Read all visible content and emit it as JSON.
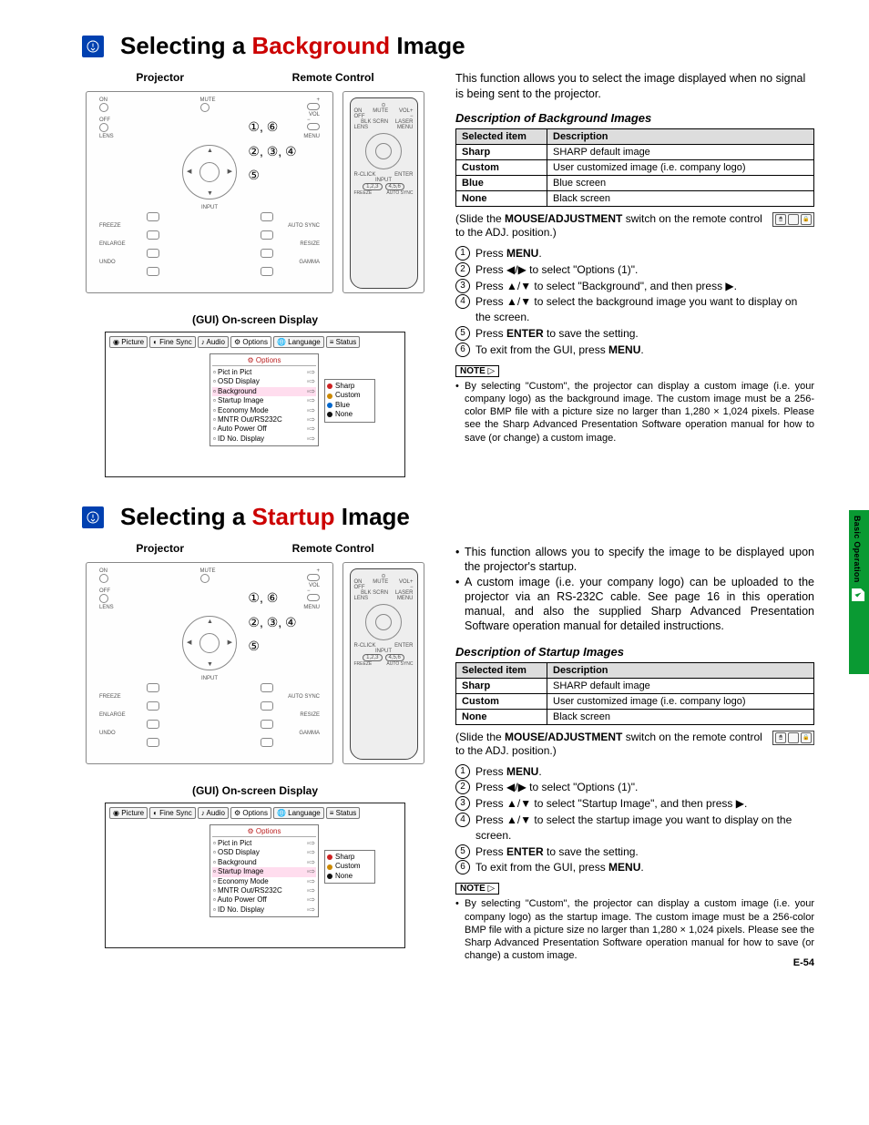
{
  "page_number": "E-54",
  "side_tab": "Basic Operation",
  "sections": [
    {
      "title_pre": "Selecting a ",
      "title_hl": "Background",
      "title_post": " Image",
      "label_projector": "Projector",
      "label_remote": "Remote Control",
      "callouts": [
        "①, ⑥",
        "②, ③, ④",
        "⑤"
      ],
      "osd_title": "(GUI) On-screen Display",
      "osd_menubar": [
        "Picture",
        "Fine Sync",
        "Audio",
        "Options",
        "Language",
        "Status"
      ],
      "osd_header": "Options",
      "osd_rows": [
        {
          "label": "Pict in Pict",
          "hi": false
        },
        {
          "label": "OSD Display",
          "hi": false
        },
        {
          "label": "Background",
          "hi": true
        },
        {
          "label": "Startup Image",
          "hi": false
        },
        {
          "label": "Economy Mode",
          "hi": false
        },
        {
          "label": "MNTR Out/RS232C",
          "hi": false
        },
        {
          "label": "Auto Power Off",
          "hi": false
        },
        {
          "label": "ID No. Display",
          "hi": false
        }
      ],
      "osd_side": [
        {
          "label": "Sharp",
          "color": "#c22"
        },
        {
          "label": "Custom",
          "color": "#c80"
        },
        {
          "label": "Blue",
          "color": "#06c"
        },
        {
          "label": "None",
          "color": "#111"
        }
      ],
      "intro": "This function allows you to select the image displayed when no signal is being sent to the projector.",
      "intro_bullets": [],
      "desc_heading": "Description of Background Images",
      "table_headers": [
        "Selected item",
        "Description"
      ],
      "table_rows": [
        [
          "Sharp",
          "SHARP default image"
        ],
        [
          "Custom",
          "User customized image (i.e. company logo)"
        ],
        [
          "Blue",
          "Blue screen"
        ],
        [
          "None",
          "Black screen"
        ]
      ],
      "slide_note_pre": "(Slide the ",
      "slide_note_bold": "MOUSE/ADJUSTMENT",
      "slide_note_post": " switch on the remote control to the ADJ. position.)",
      "switch_labels": [
        "MOUSE",
        "→",
        "ADJ."
      ],
      "steps": [
        {
          "n": "1",
          "html": "Press <b>MENU</b>."
        },
        {
          "n": "2",
          "html": "Press ◀/▶ to select \"Options (1)\"."
        },
        {
          "n": "3",
          "html": "Press ▲/▼ to select \"Background\", and then press ▶."
        },
        {
          "n": "4",
          "html": "Press ▲/▼ to select the background image you want to display on the screen."
        },
        {
          "n": "5",
          "html": "Press <b>ENTER</b> to save the setting."
        },
        {
          "n": "6",
          "html": "To exit from the GUI, press <b>MENU</b>."
        }
      ],
      "note_label": "NOTE",
      "notes": [
        "By selecting \"Custom\", the projector can display a custom image (i.e. your company logo) as the background image. The custom image must be a 256-color BMP file with a picture size no larger than 1,280 × 1,024 pixels. Please see the Sharp Advanced Presentation Software operation manual for how to save (or change) a custom image."
      ]
    },
    {
      "title_pre": "Selecting a ",
      "title_hl": "Startup",
      "title_post": " Image",
      "label_projector": "Projector",
      "label_remote": "Remote Control",
      "callouts": [
        "①, ⑥",
        "②, ③, ④",
        "⑤"
      ],
      "osd_title": "(GUI) On-screen Display",
      "osd_menubar": [
        "Picture",
        "Fine Sync",
        "Audio",
        "Options",
        "Language",
        "Status"
      ],
      "osd_header": "Options",
      "osd_rows": [
        {
          "label": "Pict in Pict",
          "hi": false
        },
        {
          "label": "OSD Display",
          "hi": false
        },
        {
          "label": "Background",
          "hi": false
        },
        {
          "label": "Startup Image",
          "hi": true
        },
        {
          "label": "Economy Mode",
          "hi": false
        },
        {
          "label": "MNTR Out/RS232C",
          "hi": false
        },
        {
          "label": "Auto Power Off",
          "hi": false
        },
        {
          "label": "ID No. Display",
          "hi": false
        }
      ],
      "osd_side": [
        {
          "label": "Sharp",
          "color": "#c22"
        },
        {
          "label": "Custom",
          "color": "#c80"
        },
        {
          "label": "None",
          "color": "#111"
        }
      ],
      "intro": "",
      "intro_bullets": [
        "This function allows you to specify the image to be displayed upon the projector's startup.",
        "A custom image (i.e. your company logo) can be uploaded to the projector via an RS-232C cable. See page 16 in this operation manual, and also the supplied Sharp Advanced Presentation Software operation manual for detailed instructions."
      ],
      "desc_heading": "Description of Startup Images",
      "table_headers": [
        "Selected item",
        "Description"
      ],
      "table_rows": [
        [
          "Sharp",
          "SHARP default image"
        ],
        [
          "Custom",
          "User customized image (i.e. company logo)"
        ],
        [
          "None",
          "Black screen"
        ]
      ],
      "slide_note_pre": "(Slide the ",
      "slide_note_bold": "MOUSE/ADJUSTMENT",
      "slide_note_post": " switch on the remote control to the ADJ. position.)",
      "switch_labels": [
        "MOUSE",
        "→",
        "ADJ."
      ],
      "steps": [
        {
          "n": "1",
          "html": "Press <b>MENU</b>."
        },
        {
          "n": "2",
          "html": "Press ◀/▶ to select \"Options (1)\"."
        },
        {
          "n": "3",
          "html": "Press ▲/▼ to select \"Startup Image\", and then press ▶."
        },
        {
          "n": "4",
          "html": "Press ▲/▼ to select the startup image you want to display on the screen."
        },
        {
          "n": "5",
          "html": "Press <b>ENTER</b> to save the setting."
        },
        {
          "n": "6",
          "html": "To exit from the GUI, press <b>MENU</b>."
        }
      ],
      "note_label": "NOTE",
      "notes": [
        "By selecting \"Custom\", the projector can display a custom image (i.e. your company logo) as the startup image. The custom image must be a 256-color BMP file with a picture size no larger than 1,280 × 1,024 pixels. Please see the Sharp Advanced Presentation Software operation manual for how to save (or change) a custom image."
      ]
    }
  ]
}
